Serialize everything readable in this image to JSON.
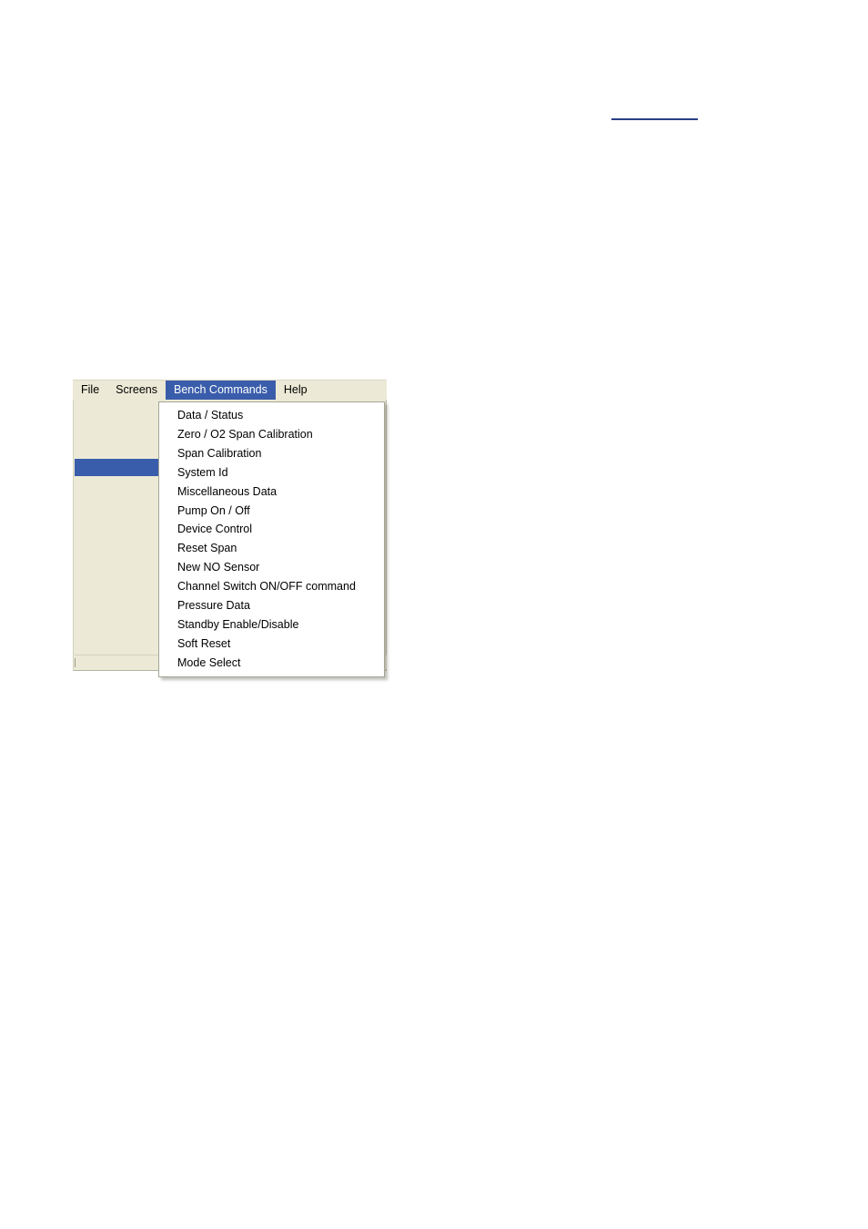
{
  "document": {
    "header_rule": "header-underline"
  },
  "app": {
    "menubar": {
      "items": [
        {
          "label": "File",
          "selected": false
        },
        {
          "label": "Screens",
          "selected": false
        },
        {
          "label": "Bench Commands",
          "selected": true
        },
        {
          "label": "Help",
          "selected": false
        }
      ]
    },
    "dropdown": {
      "owner": "Bench Commands",
      "items": [
        {
          "label": "Data / Status"
        },
        {
          "label": "Zero / O2 Span Calibration"
        },
        {
          "label": "Span Calibration"
        },
        {
          "label": "System Id"
        },
        {
          "label": "Miscellaneous Data"
        },
        {
          "label": "Pump On / Off"
        },
        {
          "label": "Device Control"
        },
        {
          "label": "Reset Span"
        },
        {
          "label": "New NO Sensor"
        },
        {
          "label": "Channel Switch ON/OFF command"
        },
        {
          "label": "Pressure Data"
        },
        {
          "label": "Standby Enable/Disable"
        },
        {
          "label": "Soft Reset"
        },
        {
          "label": "Mode Select"
        }
      ]
    },
    "statusbar": {
      "panels": [
        "",
        "",
        ""
      ]
    },
    "colors": {
      "menu_background": "#ecead6",
      "selection_blue": "#3a5dab",
      "menu_text": "#000000",
      "selected_text": "#ffffff",
      "dropdown_background": "#ffffff",
      "rule_blue": "#2b3f87"
    }
  }
}
